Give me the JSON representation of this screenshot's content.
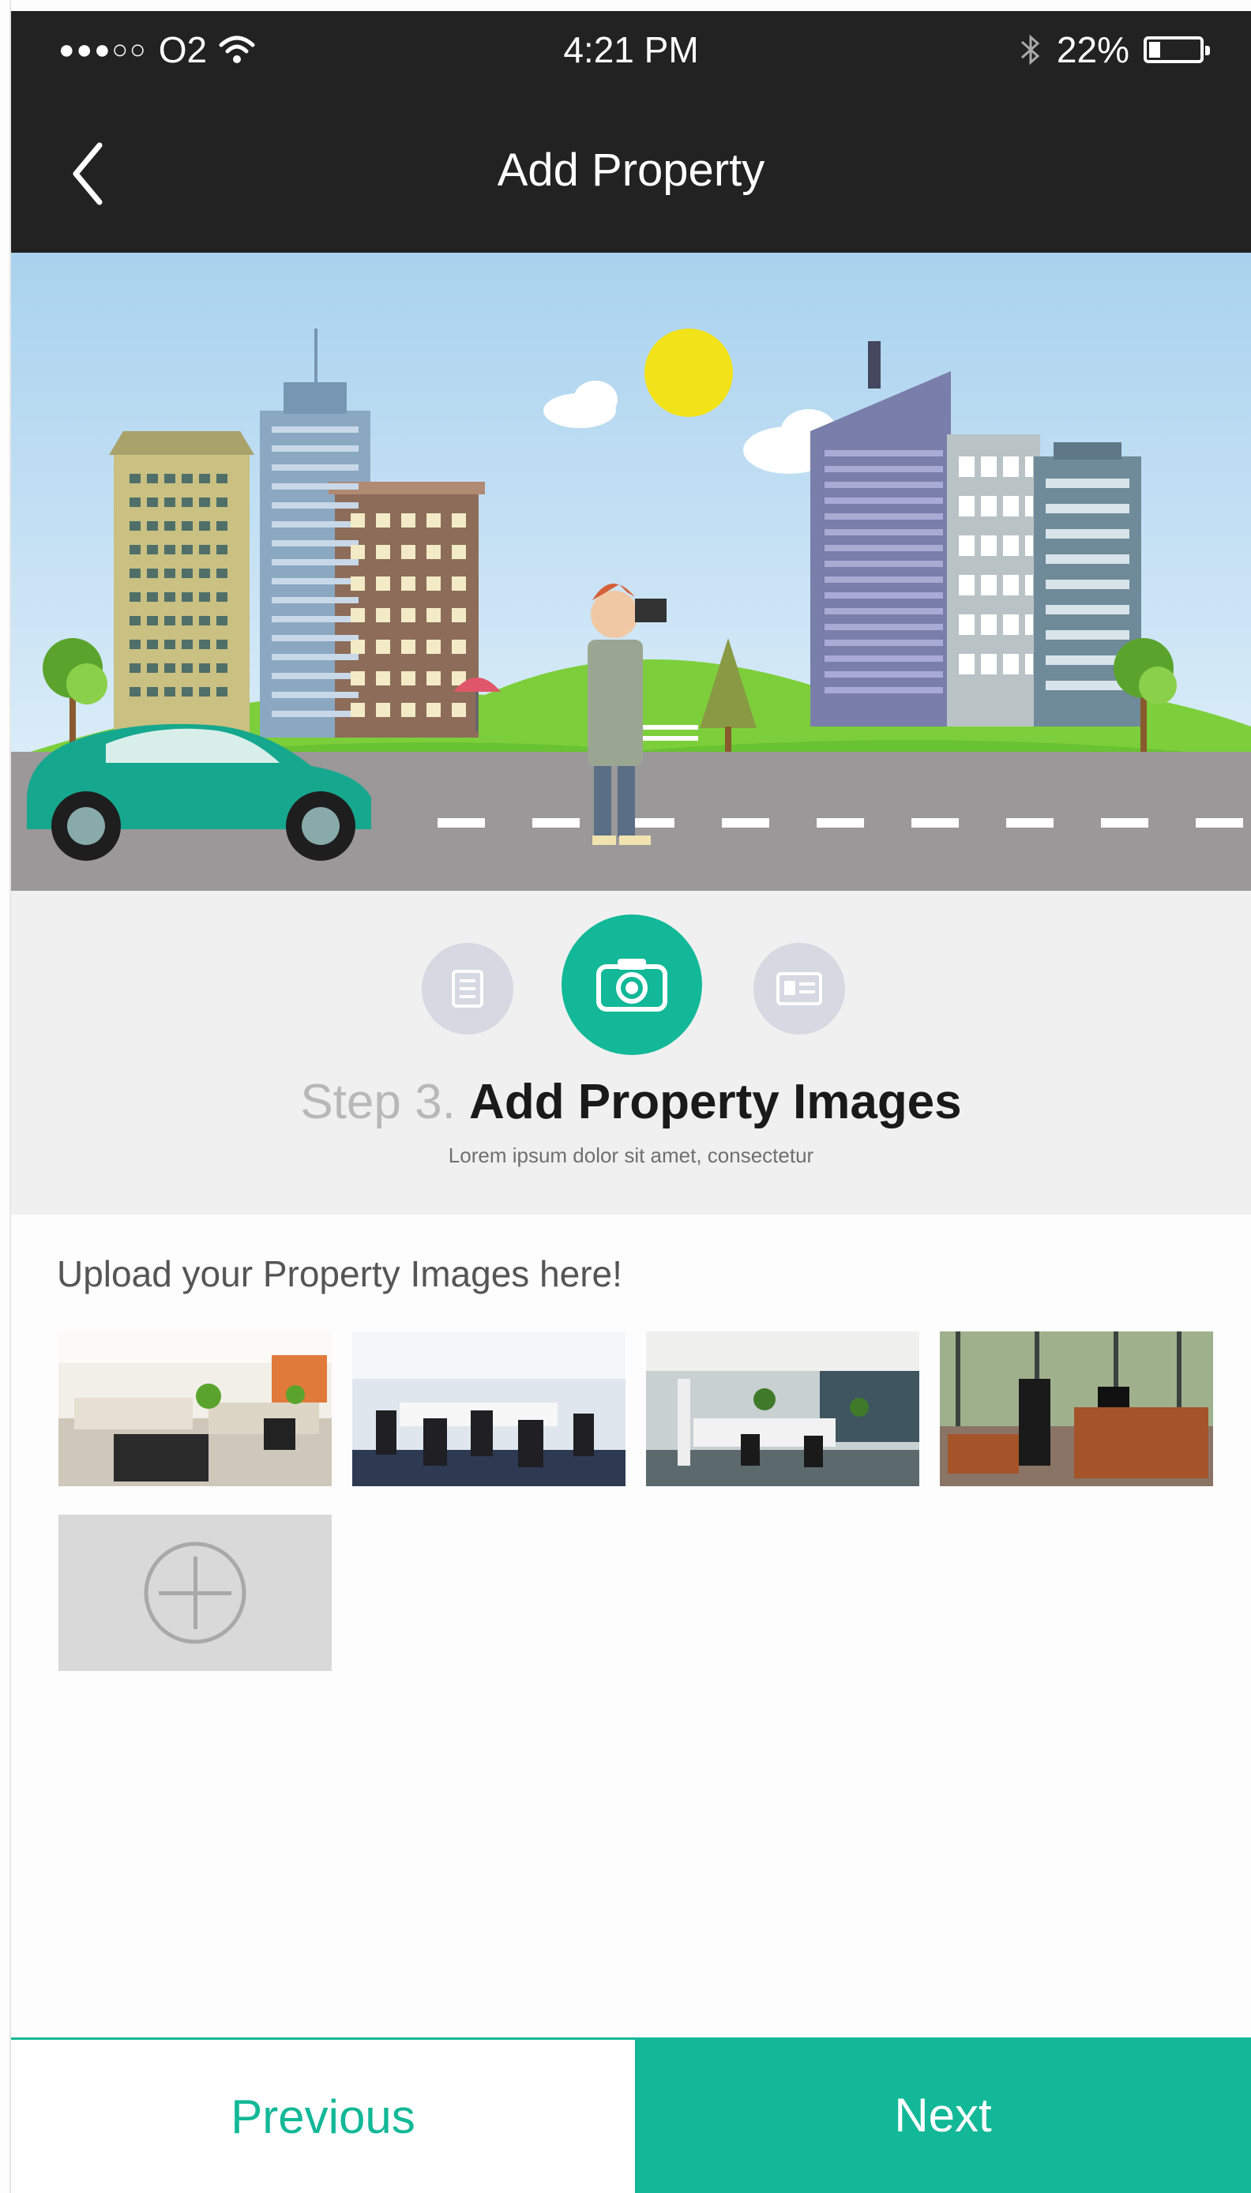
{
  "status_bar": {
    "signal_dots": "●●●○○",
    "carrier": "O2",
    "time": "4:21 PM",
    "battery_percent": "22%",
    "battery_level": 0.22,
    "icons": [
      "wifi-icon",
      "bluetooth-icon",
      "battery-icon"
    ]
  },
  "nav": {
    "title": "Add Property",
    "back_icon": "chevron-left-icon"
  },
  "steps": {
    "items": [
      {
        "icon": "document-list-icon",
        "active": false
      },
      {
        "icon": "camera-icon",
        "active": true
      },
      {
        "icon": "id-card-icon",
        "active": false
      }
    ],
    "step_prefix": "Step 3.",
    "step_title": "Add Property Images",
    "step_subtitle": "Lorem ipsum dolor sit amet, consectetur"
  },
  "upload": {
    "label": "Upload your Property Images here!",
    "add_icon": "plus-circle-icon"
  },
  "footer": {
    "previous_label": "Previous",
    "next_label": "Next"
  },
  "colors": {
    "accent": "#12b897",
    "header": "#222222",
    "step_panel": "#f0f0f0",
    "inactive_step": "#d6d8e2"
  }
}
